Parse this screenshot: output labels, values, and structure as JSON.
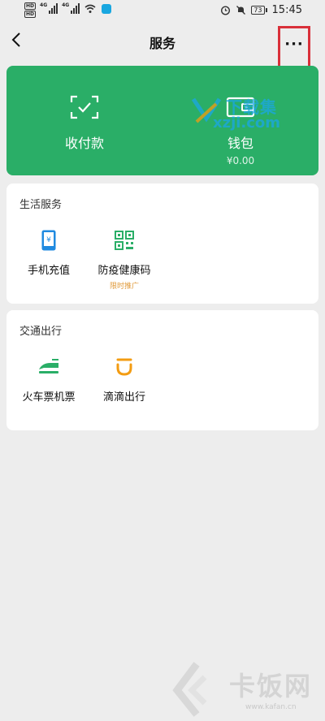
{
  "status_bar": {
    "hd_badges": [
      "HD",
      "HD"
    ],
    "net_labels": [
      "4G",
      "4G"
    ],
    "battery": "73",
    "time": "15:45"
  },
  "header": {
    "title": "服务",
    "more_label": "···"
  },
  "pay_card": {
    "pay_label": "收付款",
    "wallet_label": "钱包",
    "wallet_amount": "¥0.00",
    "accent": "#2aae67"
  },
  "sections": {
    "life": {
      "title": "生活服务",
      "items": [
        {
          "label": "手机充值",
          "icon": "phone-recharge-icon",
          "color": "#1f8ae0"
        },
        {
          "label": "防疫健康码",
          "icon": "qr-code-icon",
          "color": "#2aae67",
          "tag": "限时推广"
        }
      ]
    },
    "transport": {
      "title": "交通出行",
      "items": [
        {
          "label": "火车票机票",
          "icon": "train-icon",
          "color": "#2aae67"
        },
        {
          "label": "滴滴出行",
          "icon": "didi-icon",
          "color": "#f39c12"
        }
      ]
    }
  },
  "watermarks": {
    "top_cn": "下载集",
    "top_en": "xzji.com",
    "bottom_cn": "卡饭网",
    "bottom_url": "www.kafan.cn"
  }
}
